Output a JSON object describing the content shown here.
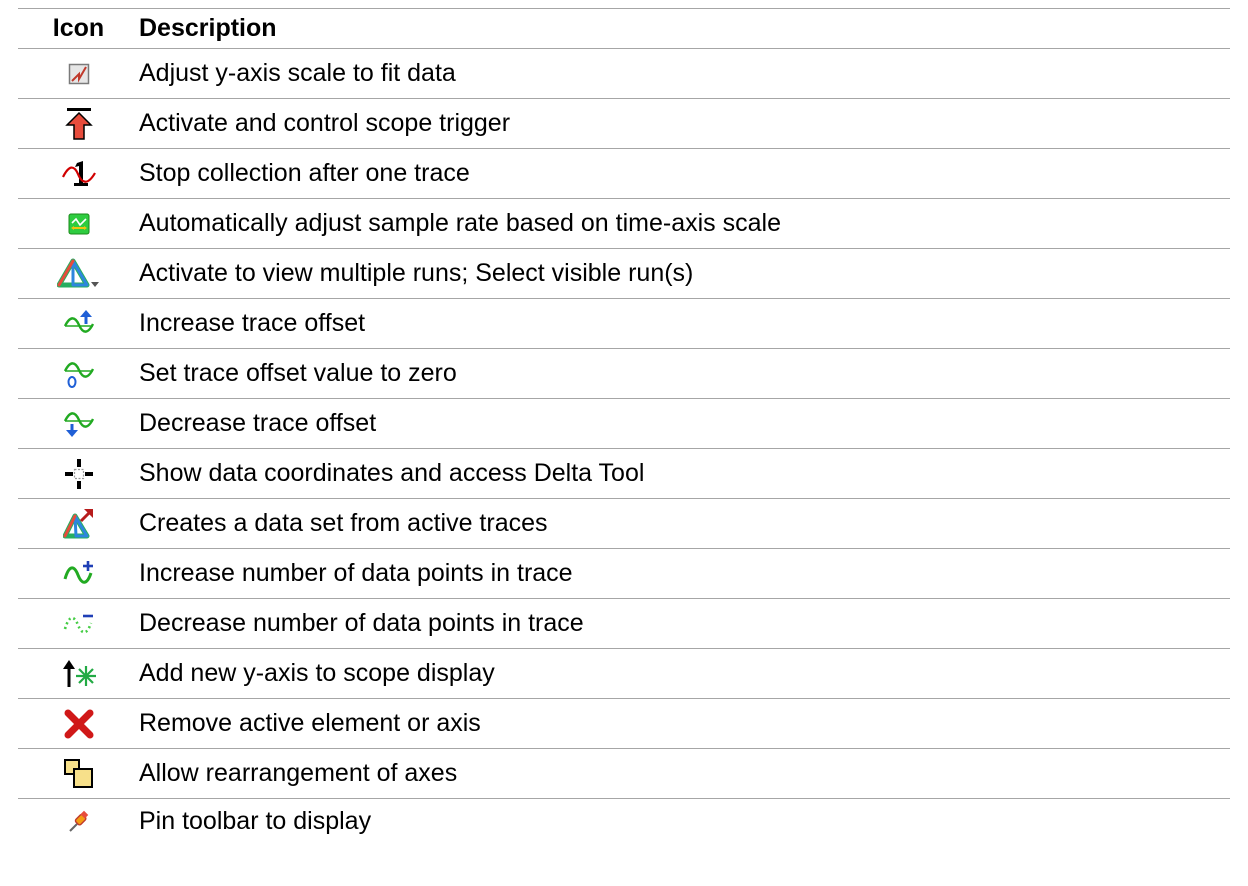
{
  "header": {
    "icon": "Icon",
    "description": "Description"
  },
  "rows": [
    {
      "icon": "fit-scale-icon",
      "description": "Adjust y-axis scale to fit data"
    },
    {
      "icon": "trigger-icon",
      "description": "Activate and control scope trigger"
    },
    {
      "icon": "single-trace-icon",
      "description": "Stop collection after one trace"
    },
    {
      "icon": "auto-sample-rate-icon",
      "description": "Automatically adjust sample rate based on time-axis scale"
    },
    {
      "icon": "multiple-runs-icon",
      "description": "Activate to view multiple runs; Select visible run(s)"
    },
    {
      "icon": "increase-offset-icon",
      "description": "Increase trace offset"
    },
    {
      "icon": "zero-offset-icon",
      "description": "Set trace offset value to zero"
    },
    {
      "icon": "decrease-offset-icon",
      "description": "Decrease trace offset"
    },
    {
      "icon": "crosshair-icon",
      "description": "Show data coordinates and access Delta Tool"
    },
    {
      "icon": "create-data-set-icon",
      "description": "Creates a data set from active traces"
    },
    {
      "icon": "increase-points-icon",
      "description": "Increase number of data points in trace"
    },
    {
      "icon": "decrease-points-icon",
      "description": "Decrease number of data points in trace"
    },
    {
      "icon": "add-y-axis-icon",
      "description": "Add new y-axis to scope display"
    },
    {
      "icon": "remove-icon",
      "description": "Remove active element or axis"
    },
    {
      "icon": "rearrange-axes-icon",
      "description": "Allow rearrangement of axes"
    },
    {
      "icon": "pin-icon",
      "description": "Pin toolbar to display"
    }
  ]
}
